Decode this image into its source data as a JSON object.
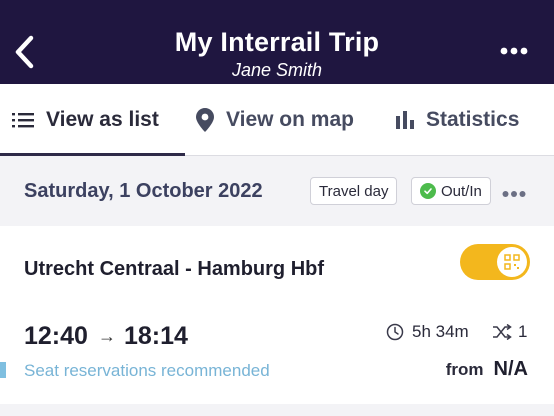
{
  "header": {
    "title": "My Interrail Trip",
    "subtitle": "Jane Smith",
    "back_icon": "chevron-left-icon",
    "more_icon": "more-horizontal-icon",
    "background": "#1f1640"
  },
  "tabs": [
    {
      "label": "View as list",
      "icon": "list-icon",
      "active": true
    },
    {
      "label": "View on map",
      "icon": "map-pin-icon",
      "active": false
    },
    {
      "label": "Statistics",
      "icon": "bar-chart-icon",
      "active": false
    }
  ],
  "day": {
    "date": "Saturday, 1 October 2022",
    "chips": {
      "travel_day": "Travel day",
      "out_in": "Out/In"
    },
    "more_icon": "more-horizontal-icon"
  },
  "journey": {
    "route": "Utrecht Centraal - Hamburg Hbf",
    "depart": "12:40",
    "arrive": "18:14",
    "duration": "5h 34m",
    "changes": "1",
    "seat_note": "Seat reservations recommended",
    "price_prefix": "from",
    "price": "N/A",
    "toggle_on": true,
    "toggle_icon": "qr-code-icon",
    "accent": "#f3b71d"
  }
}
